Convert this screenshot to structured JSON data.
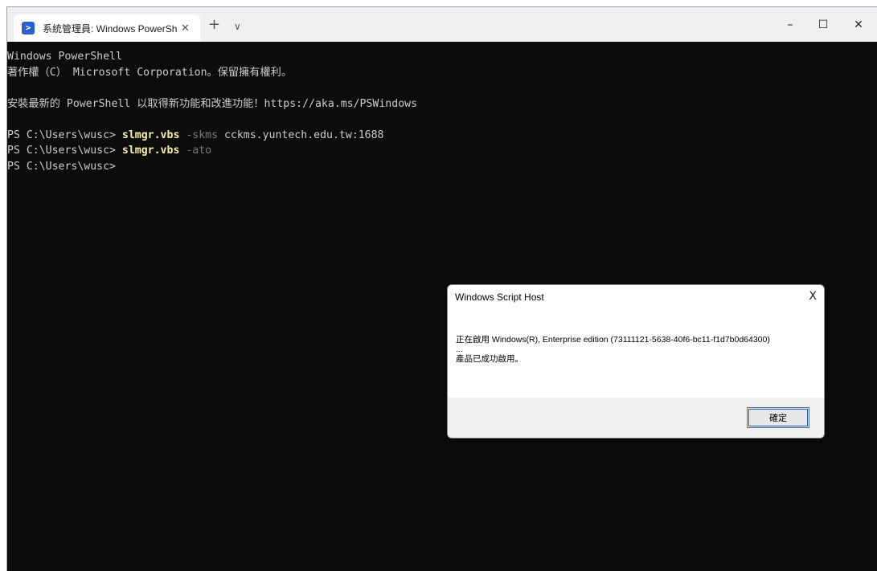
{
  "window": {
    "tab_title": "系統管理員: Windows PowerShe",
    "tab_icon": "powershell-icon",
    "tab_close": "✕",
    "tab_add": "+",
    "tab_dropdown": "∨",
    "minimize": "–",
    "maximize": "☐",
    "close": "✕"
  },
  "terminal": {
    "lines": [
      {
        "text": "Windows PowerShell"
      },
      {
        "text": "著作權（C） Microsoft Corporation。保留擁有權利。"
      },
      {
        "text": ""
      },
      {
        "text": "安裝最新的 PowerShell 以取得新功能和改進功能！https://aka.ms/PSWindows"
      },
      {
        "text": ""
      },
      {
        "prompt": "PS C:\\Users\\wusc> ",
        "cmd": "slmgr.vbs",
        "param": " -skms",
        "arg": " cckms.yuntech.edu.tw:1688"
      },
      {
        "prompt": "PS C:\\Users\\wusc> ",
        "cmd": "slmgr.vbs",
        "param": " -ato",
        "arg": ""
      },
      {
        "prompt": "PS C:\\Users\\wusc>",
        "cmd": "",
        "param": "",
        "arg": ""
      }
    ]
  },
  "dialog": {
    "title": "Windows Script Host",
    "close": "X",
    "message_line1": "正在啟用 Windows(R), Enterprise edition (73111121-5638-40f6-bc11-f1d7b0d64300)",
    "message_line2": "...",
    "message_line3": "產品已成功啟用。",
    "ok_label": "確定"
  },
  "colors": {
    "terminal_bg": "#0c0c0c",
    "terminal_fg": "#cccccc",
    "command": "#f9f1a5",
    "parameter": "#7a7a7a"
  }
}
